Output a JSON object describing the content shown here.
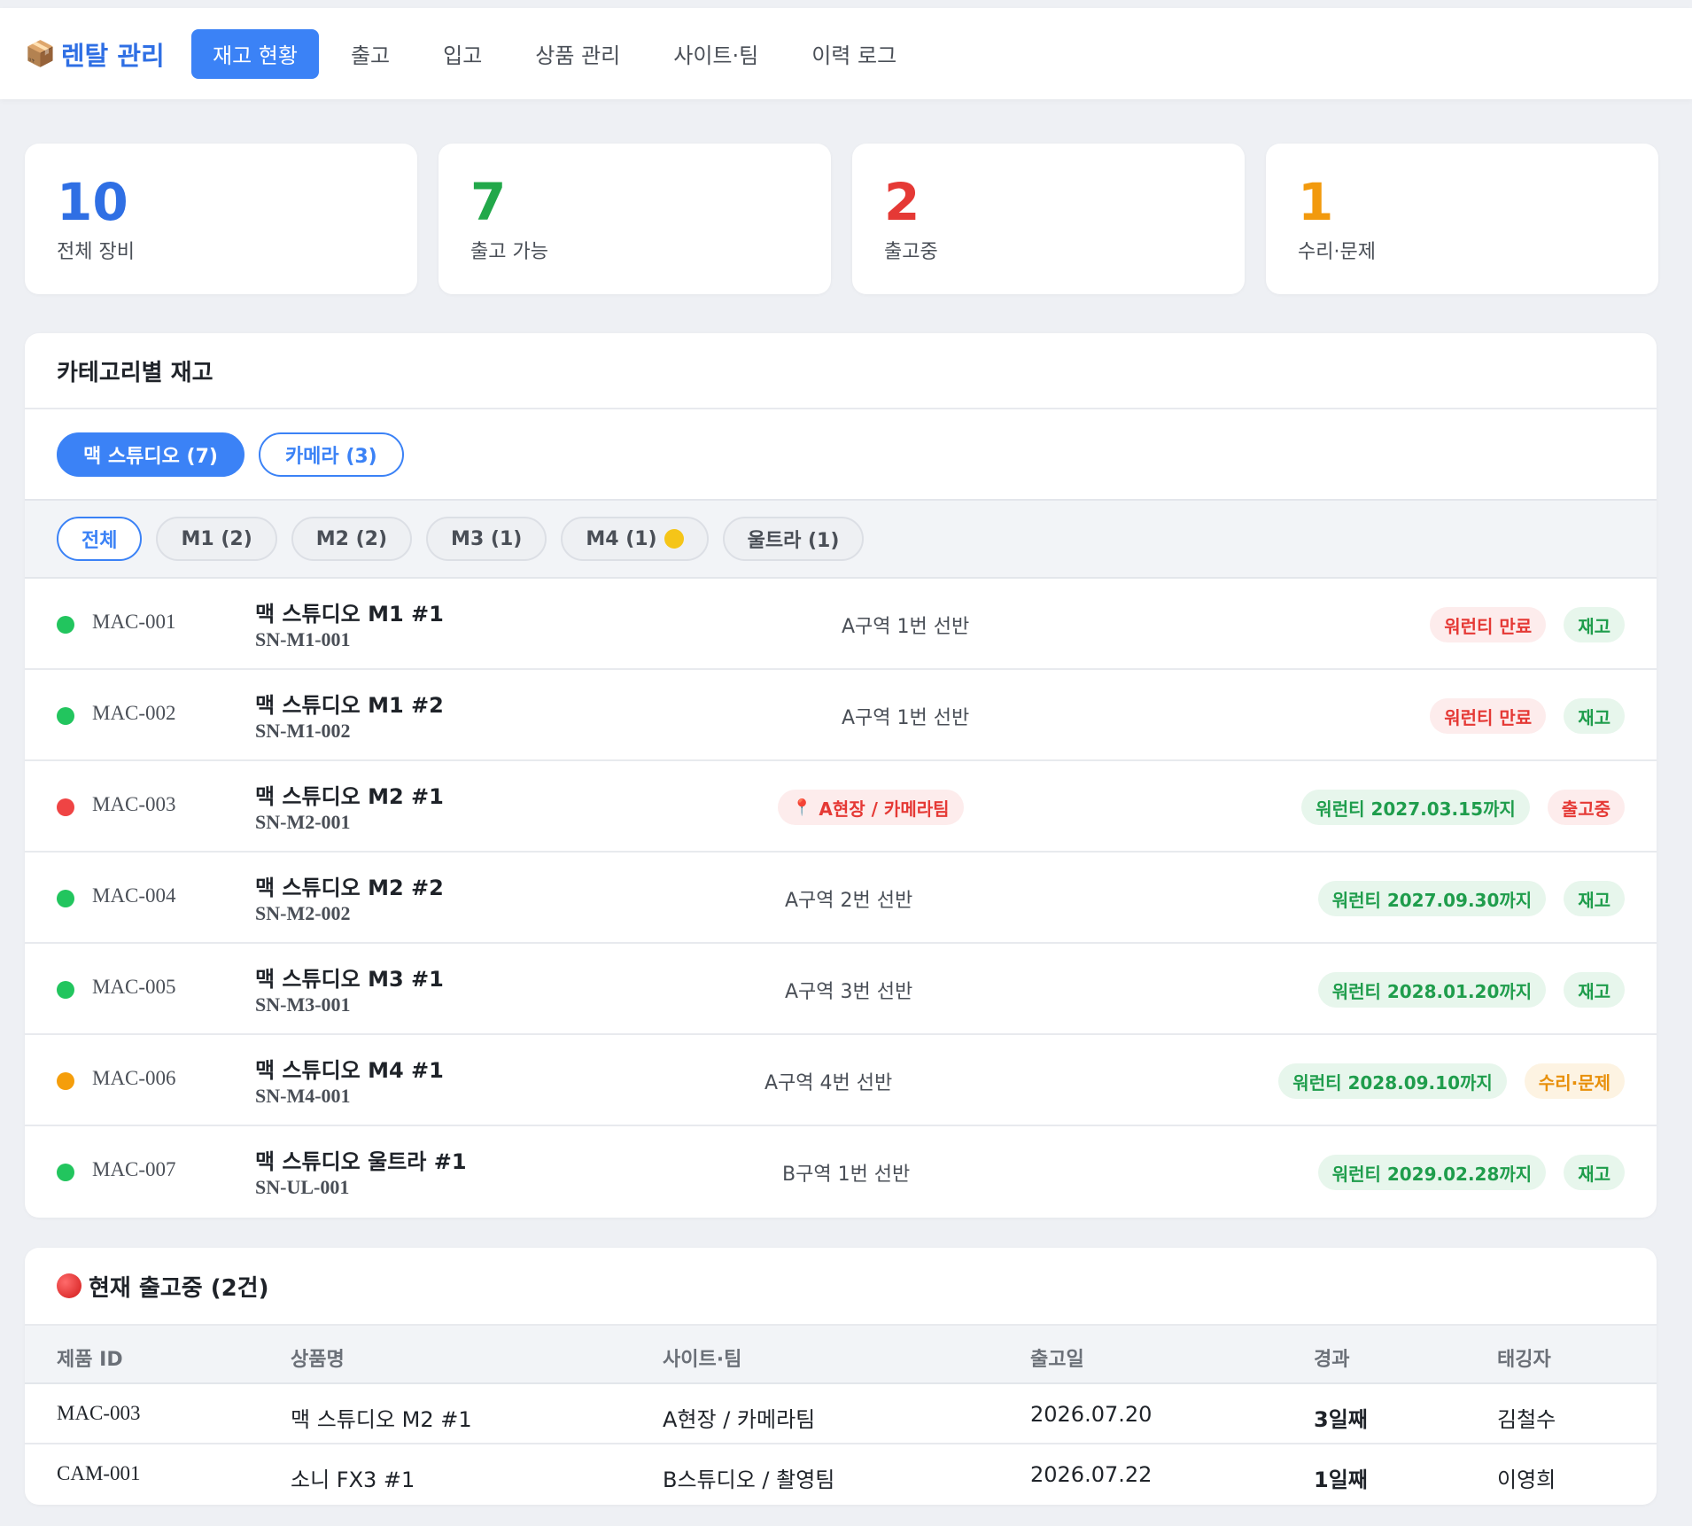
{
  "brand": {
    "icon": "package-icon",
    "title": "렌탈 관리"
  },
  "nav": [
    {
      "label": "재고 현황",
      "active": true
    },
    {
      "label": "출고"
    },
    {
      "label": "입고"
    },
    {
      "label": "상품 관리"
    },
    {
      "label": "사이트·팀"
    },
    {
      "label": "이력 로그"
    }
  ],
  "stats": [
    {
      "value": "10",
      "label": "전체 장비",
      "color": "#2f6fe4"
    },
    {
      "value": "7",
      "label": "출고 가능",
      "color": "#22a84a"
    },
    {
      "value": "2",
      "label": "출고중",
      "color": "#e53935"
    },
    {
      "value": "1",
      "label": "수리·문제",
      "color": "#f29a0e"
    }
  ],
  "inventory": {
    "title": "카테고리별 재고",
    "categories": [
      "맥 스튜디오 (7)",
      "카메라 (3)"
    ],
    "filters": [
      "전체",
      "M1 (2)",
      "M2 (2)",
      "M3 (1)",
      "M4 (1)",
      "울트라 (1)"
    ],
    "items": [
      {
        "id": "MAC-001",
        "name": "맥 스튜디오 M1 #1",
        "sn": "SN-M1-001",
        "location": "A구역 1번 선반",
        "warranty": "워런티 만료",
        "status": "재고",
        "dot": "#22c55e"
      },
      {
        "id": "MAC-002",
        "name": "맥 스튜디오 M1 #2",
        "sn": "SN-M1-002",
        "location": "A구역 1번 선반",
        "warranty": "워런티 만료",
        "status": "재고",
        "dot": "#22c55e"
      },
      {
        "id": "MAC-003",
        "name": "맥 스튜디오 M2 #1",
        "sn": "SN-M2-001",
        "location": "A현장 / 카메라팀",
        "warranty": "워런티 2027.03.15까지",
        "status": "출고중",
        "dot": "#ef4444"
      },
      {
        "id": "MAC-004",
        "name": "맥 스튜디오 M2 #2",
        "sn": "SN-M2-002",
        "location": "A구역 2번 선반",
        "warranty": "워런티 2027.09.30까지",
        "status": "재고",
        "dot": "#22c55e"
      },
      {
        "id": "MAC-005",
        "name": "맥 스튜디오 M3 #1",
        "sn": "SN-M3-001",
        "location": "A구역 3번 선반",
        "warranty": "워런티 2028.01.20까지",
        "status": "재고",
        "dot": "#22c55e"
      },
      {
        "id": "MAC-006",
        "name": "맥 스튜디오 M4 #1",
        "sn": "SN-M4-001",
        "location": "A구역 4번 선반",
        "warranty": "워런티 2028.09.10까지",
        "status": "수리·문제",
        "dot": "#f59e0b"
      },
      {
        "id": "MAC-007",
        "name": "맥 스튜디오 울트라 #1",
        "sn": "SN-UL-001",
        "location": "B구역 1번 선반",
        "warranty": "워런티 2029.02.28까지",
        "status": "재고",
        "dot": "#22c55e"
      }
    ]
  },
  "checkout": {
    "title": "현재 출고중 (2건)",
    "columns": [
      "제품 ID",
      "상품명",
      "사이트·팀",
      "출고일",
      "경과",
      "태깅자"
    ],
    "rows": [
      [
        "MAC-003",
        "맥 스튜디오 M2 #1",
        "A현장 / 카메라팀",
        "2026.07.20",
        "3일째",
        "김철수"
      ],
      [
        "CAM-001",
        "소니 FX3 #1",
        "B스튜디오 / 촬영팀",
        "2026.07.22",
        "1일째",
        "이영희"
      ]
    ]
  }
}
